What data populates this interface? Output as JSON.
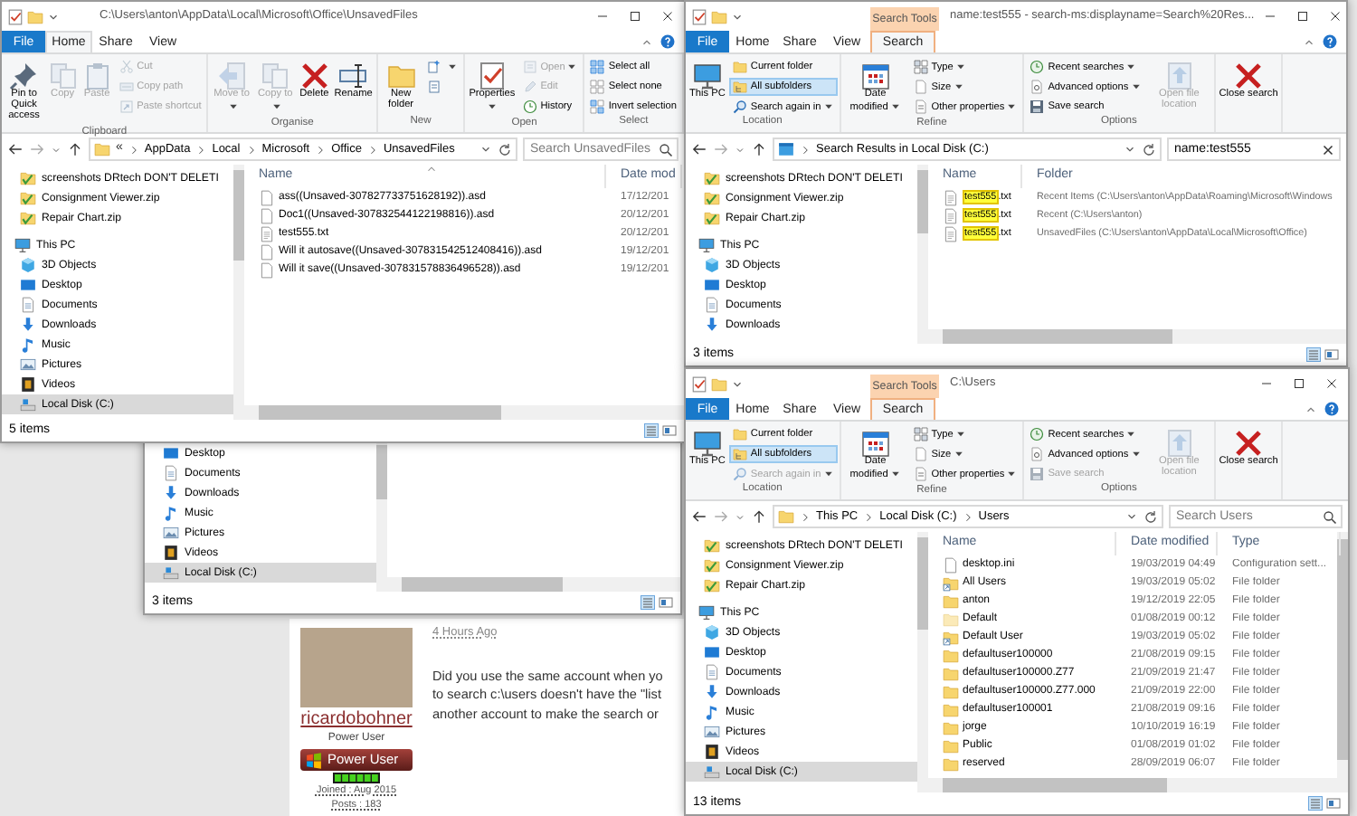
{
  "windows": [
    {
      "kind": "full",
      "title": "C:\\Users\\anton\\AppData\\Local\\Microsoft\\Office\\UnsavedFiles",
      "tabs": [
        {
          "label": "File",
          "kind": "file",
          "selected": false
        },
        {
          "label": "Home",
          "kind": "normal",
          "selected": true
        },
        {
          "label": "Share",
          "kind": "normal",
          "selected": false
        },
        {
          "label": "View",
          "kind": "normal",
          "selected": false
        }
      ],
      "ribbon": [
        {
          "label": "Clipboard",
          "columns": [
            [
              {
                "label": "Pin to Quick access",
                "kind": "pin",
                "large": true,
                "disabled": false
              }
            ],
            [
              {
                "label": "Copy",
                "kind": "copy",
                "large": true,
                "disabled": true
              }
            ],
            [
              {
                "label": "Paste",
                "kind": "paste",
                "large": true,
                "disabled": true
              }
            ],
            [
              {
                "label": "Cut",
                "kind": "cut",
                "large": false,
                "disabled": true
              },
              {
                "label": "Copy path",
                "kind": "path",
                "large": false,
                "disabled": true
              },
              {
                "label": "Paste shortcut",
                "kind": "shortcut",
                "large": false,
                "disabled": true
              }
            ]
          ]
        },
        {
          "label": "Organise",
          "columns": [
            [
              {
                "label": "Move to",
                "kind": "move",
                "large": true,
                "disabled": true,
                "dropdown": true
              }
            ],
            [
              {
                "label": "Copy to",
                "kind": "copyto",
                "large": true,
                "disabled": true,
                "dropdown": true
              }
            ],
            [
              {
                "label": "Delete",
                "kind": "x",
                "large": true,
                "disabled": false
              }
            ],
            [
              {
                "label": "Rename",
                "kind": "rename",
                "large": true,
                "disabled": false
              }
            ]
          ]
        },
        {
          "label": "New",
          "columns": [
            [
              {
                "label": "New folder",
                "kind": "folder",
                "large": true,
                "disabled": false
              }
            ],
            [
              {
                "kind": "newitem",
                "large": false,
                "disabled": false,
                "dropdown": true
              },
              {
                "kind": "easy",
                "large": false,
                "disabled": false
              }
            ]
          ]
        },
        {
          "label": "Open",
          "columns": [
            [
              {
                "label": "Properties",
                "kind": "props",
                "large": true,
                "disabled": false,
                "dropdown": true
              }
            ],
            [
              {
                "label": "Open",
                "kind": "open",
                "large": false,
                "disabled": true,
                "dropdown": true
              },
              {
                "label": "Edit",
                "kind": "edit",
                "large": false,
                "disabled": true
              },
              {
                "label": "History",
                "kind": "history",
                "large": false,
                "disabled": false
              }
            ]
          ]
        },
        {
          "label": "Select",
          "columns": [
            [
              {
                "label": "Select all",
                "kind": "selectall",
                "large": false,
                "disabled": false
              },
              {
                "label": "Select none",
                "kind": "selectnone",
                "large": false,
                "disabled": false
              },
              {
                "label": "Invert selection",
                "kind": "invert",
                "large": false,
                "disabled": false
              }
            ]
          ]
        }
      ],
      "address": {
        "kind": "folder",
        "overflow": "«",
        "segments": [
          "AppData",
          "Local",
          "Microsoft",
          "Office",
          "UnsavedFiles"
        ]
      },
      "search": {
        "placeholder": "Search UnsavedFiles"
      },
      "nav": [
        {
          "label": "screenshots DRtech DON'T DELETI",
          "kind": "zip",
          "selected": false
        },
        {
          "label": "Consignment Viewer.zip",
          "kind": "zip",
          "selected": false
        },
        {
          "label": "Repair Chart.zip",
          "kind": "zip",
          "selected": false
        },
        {
          "label": "This PC",
          "kind": "pc",
          "selected": false,
          "children": [
            {
              "label": "3D Objects",
              "kind": "cube",
              "selected": false
            },
            {
              "label": "Desktop",
              "kind": "desktop",
              "selected": false
            },
            {
              "label": "Documents",
              "kind": "document",
              "selected": false
            },
            {
              "label": "Downloads",
              "kind": "download",
              "selected": false
            },
            {
              "label": "Music",
              "kind": "music",
              "selected": false
            },
            {
              "label": "Pictures",
              "kind": "picture",
              "selected": false
            },
            {
              "label": "Videos",
              "kind": "video",
              "selected": false
            },
            {
              "label": "Local Disk (C:)",
              "kind": "disk",
              "selected": true
            }
          ]
        }
      ],
      "columns": [
        {
          "label": "Name",
          "sorted": true
        },
        {
          "label": "Date mod",
          "sorted": false
        }
      ],
      "rows": [
        {
          "kind": "file",
          "cells": [
            "ass((Unsaved-307827733751628192)).asd",
            "17/12/201"
          ]
        },
        {
          "kind": "file",
          "cells": [
            "Doc1((Unsaved-307832544122198816)).asd",
            "20/12/201"
          ]
        },
        {
          "kind": "text",
          "cells": [
            "test555.txt",
            "20/12/201"
          ]
        },
        {
          "kind": "file",
          "cells": [
            "Will it autosave((Unsaved-307831542512408416)).asd",
            "19/12/201"
          ]
        },
        {
          "kind": "file",
          "cells": [
            "Will it save((Unsaved-307831578836496528)).asd",
            "19/12/201"
          ]
        }
      ],
      "status": "5 items"
    },
    {
      "kind": "full",
      "title": "name:test555 - search-ms:displayname=Search%20Res...",
      "context_tab": "Search Tools",
      "tabs": [
        {
          "label": "File",
          "kind": "file",
          "selected": false
        },
        {
          "label": "Home",
          "kind": "normal",
          "selected": false
        },
        {
          "label": "Share",
          "kind": "normal",
          "selected": false
        },
        {
          "label": "View",
          "kind": "normal",
          "selected": false
        },
        {
          "label": "Search",
          "kind": "context",
          "selected": true
        }
      ],
      "ribbon": [
        {
          "label": "Location",
          "columns": [
            [
              {
                "label": "This PC",
                "kind": "pc",
                "large": true,
                "disabled": false
              }
            ],
            [
              {
                "label": "Current folder",
                "kind": "folder",
                "large": false,
                "disabled": false,
                "on": false
              },
              {
                "label": "All subfolders",
                "kind": "subfolders",
                "large": false,
                "disabled": false,
                "on": true
              },
              {
                "label": "Search again in",
                "kind": "searchin",
                "large": false,
                "disabled": false,
                "dropdown": true,
                "on": false
              }
            ]
          ]
        },
        {
          "label": "Refine",
          "columns": [
            [
              {
                "label": "Date modified",
                "kind": "calendar",
                "large": true,
                "disabled": false,
                "dropdown": true
              }
            ],
            [
              {
                "label": "Type",
                "kind": "type",
                "large": false,
                "disabled": false,
                "dropdown": true
              },
              {
                "label": "Size",
                "kind": "size",
                "large": false,
                "disabled": false,
                "dropdown": true
              },
              {
                "label": "Other properties",
                "kind": "other",
                "large": false,
                "disabled": false,
                "dropdown": true
              }
            ]
          ]
        },
        {
          "label": "Options",
          "columns": [
            [
              {
                "label": "Recent searches",
                "kind": "recent",
                "large": false,
                "disabled": false,
                "dropdown": true
              },
              {
                "label": "Advanced options",
                "kind": "options",
                "large": false,
                "disabled": false,
                "dropdown": true
              },
              {
                "label": "Save search",
                "kind": "save",
                "large": false,
                "disabled": false
              }
            ],
            [
              {
                "label": "Open file location",
                "kind": "location",
                "large": true,
                "disabled": true
              }
            ]
          ]
        },
        {
          "columns": [
            [
              {
                "label": "Close search",
                "kind": "x",
                "large": true,
                "disabled": false
              }
            ]
          ]
        }
      ],
      "address": {
        "kind": "results",
        "segments": [
          "Search Results in Local Disk (C:)"
        ]
      },
      "search": {
        "value": "name:test555"
      },
      "nav": [
        {
          "label": "screenshots DRtech DON'T DELETI",
          "kind": "zip",
          "selected": false
        },
        {
          "label": "Consignment Viewer.zip",
          "kind": "zip",
          "selected": false
        },
        {
          "label": "Repair Chart.zip",
          "kind": "zip",
          "selected": false
        },
        {
          "label": "This PC",
          "kind": "pc",
          "selected": false,
          "children": [
            {
              "label": "3D Objects",
              "kind": "cube",
              "selected": false
            },
            {
              "label": "Desktop",
              "kind": "desktop",
              "selected": false
            },
            {
              "label": "Documents",
              "kind": "document",
              "selected": false
            },
            {
              "label": "Downloads",
              "kind": "download",
              "selected": false
            }
          ]
        }
      ],
      "columns": [
        {
          "label": "Name",
          "sorted": false
        },
        {
          "label": "Folder",
          "sorted": false
        }
      ],
      "rows": [
        {
          "kind": "text",
          "match": "test555",
          "cells": [
            ".txt",
            "Recent Items (C:\\Users\\anton\\AppData\\Roaming\\Microsoft\\Windows"
          ]
        },
        {
          "kind": "text",
          "match": "test555",
          "cells": [
            ".txt",
            "Recent (C:\\Users\\anton)"
          ]
        },
        {
          "kind": "text",
          "match": "test555",
          "cells": [
            ".txt",
            "UnsavedFiles (C:\\Users\\anton\\AppData\\Local\\Microsoft\\Office)"
          ]
        }
      ],
      "status": "3 items"
    },
    {
      "kind": "partial",
      "nav": [
        {
          "label": "Desktop",
          "kind": "desktop",
          "selected": false
        },
        {
          "label": "Documents",
          "kind": "document",
          "selected": false
        },
        {
          "label": "Downloads",
          "kind": "download",
          "selected": false
        },
        {
          "label": "Music",
          "kind": "music",
          "selected": false
        },
        {
          "label": "Pictures",
          "kind": "picture",
          "selected": false
        },
        {
          "label": "Videos",
          "kind": "video",
          "selected": false
        },
        {
          "label": "Local Disk (C:)",
          "kind": "disk",
          "selected": true
        }
      ],
      "status": "3 items"
    },
    {
      "kind": "full",
      "title": "C:\\Users",
      "context_tab": "Search Tools",
      "tabs": [
        {
          "label": "File",
          "kind": "file",
          "selected": false
        },
        {
          "label": "Home",
          "kind": "normal",
          "selected": false
        },
        {
          "label": "Share",
          "kind": "normal",
          "selected": false
        },
        {
          "label": "View",
          "kind": "normal",
          "selected": false
        },
        {
          "label": "Search",
          "kind": "context",
          "selected": true
        }
      ],
      "ribbon": [
        {
          "label": "Location",
          "columns": [
            [
              {
                "label": "This PC",
                "kind": "pc",
                "large": true,
                "disabled": false
              }
            ],
            [
              {
                "label": "Current folder",
                "kind": "folder",
                "large": false,
                "disabled": false,
                "on": false
              },
              {
                "label": "All subfolders",
                "kind": "subfolders",
                "large": false,
                "disabled": false,
                "on": true
              },
              {
                "label": "Search again in",
                "kind": "searchin",
                "large": false,
                "disabled": true,
                "dropdown": true,
                "on": false
              }
            ]
          ]
        },
        {
          "label": "Refine",
          "columns": [
            [
              {
                "label": "Date modified",
                "kind": "calendar",
                "large": true,
                "disabled": false,
                "dropdown": true
              }
            ],
            [
              {
                "label": "Type",
                "kind": "type",
                "large": false,
                "disabled": false,
                "dropdown": true
              },
              {
                "label": "Size",
                "kind": "size",
                "large": false,
                "disabled": false,
                "dropdown": true
              },
              {
                "label": "Other properties",
                "kind": "other",
                "large": false,
                "disabled": false,
                "dropdown": true
              }
            ]
          ]
        },
        {
          "label": "Options",
          "columns": [
            [
              {
                "label": "Recent searches",
                "kind": "recent",
                "large": false,
                "disabled": false,
                "dropdown": true
              },
              {
                "label": "Advanced options",
                "kind": "options",
                "large": false,
                "disabled": false,
                "dropdown": true
              },
              {
                "label": "Save search",
                "kind": "save",
                "large": false,
                "disabled": true
              }
            ],
            [
              {
                "label": "Open file location",
                "kind": "location",
                "large": true,
                "disabled": true
              }
            ]
          ]
        },
        {
          "columns": [
            [
              {
                "label": "Close search",
                "kind": "x",
                "large": true,
                "disabled": false
              }
            ]
          ]
        }
      ],
      "address": {
        "kind": "folder",
        "segments": [
          "This PC",
          "Local Disk (C:)",
          "Users"
        ]
      },
      "search": {
        "placeholder": "Search Users"
      },
      "nav": [
        {
          "label": "screenshots DRtech DON'T DELETI",
          "kind": "zip",
          "selected": false
        },
        {
          "label": "Consignment Viewer.zip",
          "kind": "zip",
          "selected": false
        },
        {
          "label": "Repair Chart.zip",
          "kind": "zip",
          "selected": false
        },
        {
          "label": "This PC",
          "kind": "pc",
          "selected": false,
          "children": [
            {
              "label": "3D Objects",
              "kind": "cube",
              "selected": false
            },
            {
              "label": "Desktop",
              "kind": "desktop",
              "selected": false
            },
            {
              "label": "Documents",
              "kind": "document",
              "selected": false
            },
            {
              "label": "Downloads",
              "kind": "download",
              "selected": false
            },
            {
              "label": "Music",
              "kind": "music",
              "selected": false
            },
            {
              "label": "Pictures",
              "kind": "picture",
              "selected": false
            },
            {
              "label": "Videos",
              "kind": "video",
              "selected": false
            },
            {
              "label": "Local Disk (C:)",
              "kind": "disk",
              "selected": true
            }
          ]
        }
      ],
      "columns": [
        {
          "label": "Name",
          "sorted": false
        },
        {
          "label": "Date modified",
          "sorted": false
        },
        {
          "label": "Type",
          "sorted": false
        }
      ],
      "rows": [
        {
          "kind": "file",
          "cells": [
            "desktop.ini",
            "19/03/2019 04:49",
            "Configuration sett..."
          ]
        },
        {
          "kind": "link",
          "cells": [
            "All Users",
            "19/03/2019 05:02",
            "File folder"
          ]
        },
        {
          "kind": "folder",
          "cells": [
            "anton",
            "19/12/2019 22:05",
            "File folder"
          ]
        },
        {
          "kind": "hidden",
          "cells": [
            "Default",
            "01/08/2019 00:12",
            "File folder"
          ]
        },
        {
          "kind": "link",
          "cells": [
            "Default User",
            "19/03/2019 05:02",
            "File folder"
          ]
        },
        {
          "kind": "folder",
          "cells": [
            "defaultuser100000",
            "21/08/2019 09:15",
            "File folder"
          ]
        },
        {
          "kind": "folder",
          "cells": [
            "defaultuser100000.Z77",
            "21/09/2019 21:47",
            "File folder"
          ]
        },
        {
          "kind": "folder",
          "cells": [
            "defaultuser100000.Z77.000",
            "21/09/2019 22:00",
            "File folder"
          ]
        },
        {
          "kind": "folder",
          "cells": [
            "defaultuser100001",
            "21/08/2019 09:16",
            "File folder"
          ]
        },
        {
          "kind": "folder",
          "cells": [
            "jorge",
            "10/10/2019 16:19",
            "File folder"
          ]
        },
        {
          "kind": "folder",
          "cells": [
            "Public",
            "01/08/2019 01:02",
            "File folder"
          ]
        },
        {
          "kind": "folder",
          "cells": [
            "reserved",
            "28/09/2019 06:07",
            "File folder"
          ]
        }
      ],
      "status": "13 items"
    }
  ],
  "post": {
    "time": "4 Hours Ago",
    "text": "Did you use the same account when yo\nto search c:\\users doesn't have the \"list\nanother account to make the search or",
    "author": "ricardobohner",
    "role": "Power User",
    "rank_badge": "Power User",
    "joined": "Joined : Aug 2015",
    "posts": "Posts : 183"
  }
}
